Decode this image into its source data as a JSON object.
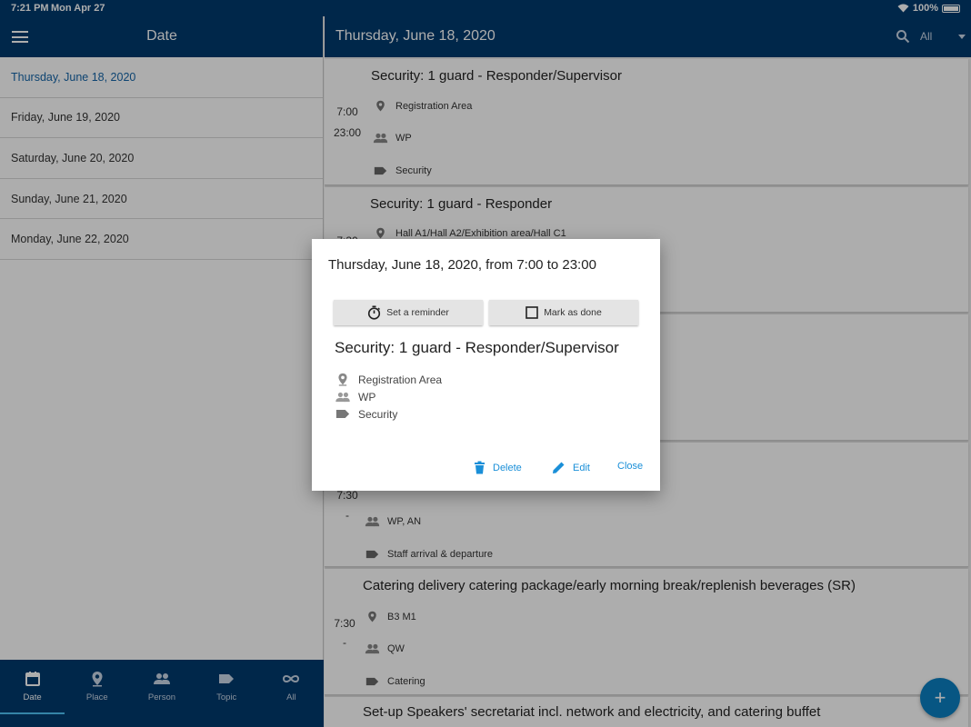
{
  "status_bar": {
    "time": "7:21 PM",
    "date": "Mon Apr 27",
    "battery": "100%"
  },
  "left_pane": {
    "title": "Date",
    "dates": [
      "Thursday, June 18, 2020",
      "Friday, June 19, 2020",
      "Saturday, June 20, 2020",
      "Sunday, June 21, 2020",
      "Monday, June 22, 2020"
    ],
    "selected_index": 0
  },
  "bottom_nav": [
    {
      "label": "Date",
      "icon": "calendar-icon",
      "active": true
    },
    {
      "label": "Place",
      "icon": "location-pin-icon",
      "active": false
    },
    {
      "label": "Person",
      "icon": "people-icon",
      "active": false
    },
    {
      "label": "Topic",
      "icon": "tag-icon",
      "active": false
    },
    {
      "label": "All",
      "icon": "infinity-icon",
      "active": false
    }
  ],
  "right_pane": {
    "title": "Thursday, June 18, 2020",
    "filter": "All",
    "events": [
      {
        "title": "Security: 1 guard - Responder/Supervisor",
        "start": "7:00",
        "end": "23:00",
        "place": "Registration Area",
        "person": "WP",
        "topic": "Security"
      },
      {
        "title": "Security: 1 guard - Responder",
        "start": "7:30",
        "place": "Hall A1/Hall A2/Exhibition area/Hall C1"
      },
      {
        "start": "7:30",
        "dash": "-",
        "person": "WP, AN",
        "topic": "Staff arrival & departure"
      },
      {
        "title": "Catering delivery catering package/early morning break/replenish beverages (SR)",
        "start": "7:30",
        "dash": "-",
        "place": "B3 M1",
        "person": "QW",
        "topic": "Catering"
      },
      {
        "title": "Set-up Speakers' secretariat incl. network and electricity, and catering buffet"
      }
    ]
  },
  "dialog": {
    "heading": "Thursday, June 18, 2020, from 7:00 to 23:00",
    "reminder_label": "Set a reminder",
    "mark_done_label": "Mark as done",
    "title": "Security: 1 guard - Responder/Supervisor",
    "place": "Registration Area",
    "person": "WP",
    "topic": "Security",
    "delete_label": "Delete",
    "edit_label": "Edit",
    "close_label": "Close"
  },
  "colors": {
    "header": "#003a6e",
    "accent": "#1a8fd8",
    "fab": "#0b7fc1"
  }
}
